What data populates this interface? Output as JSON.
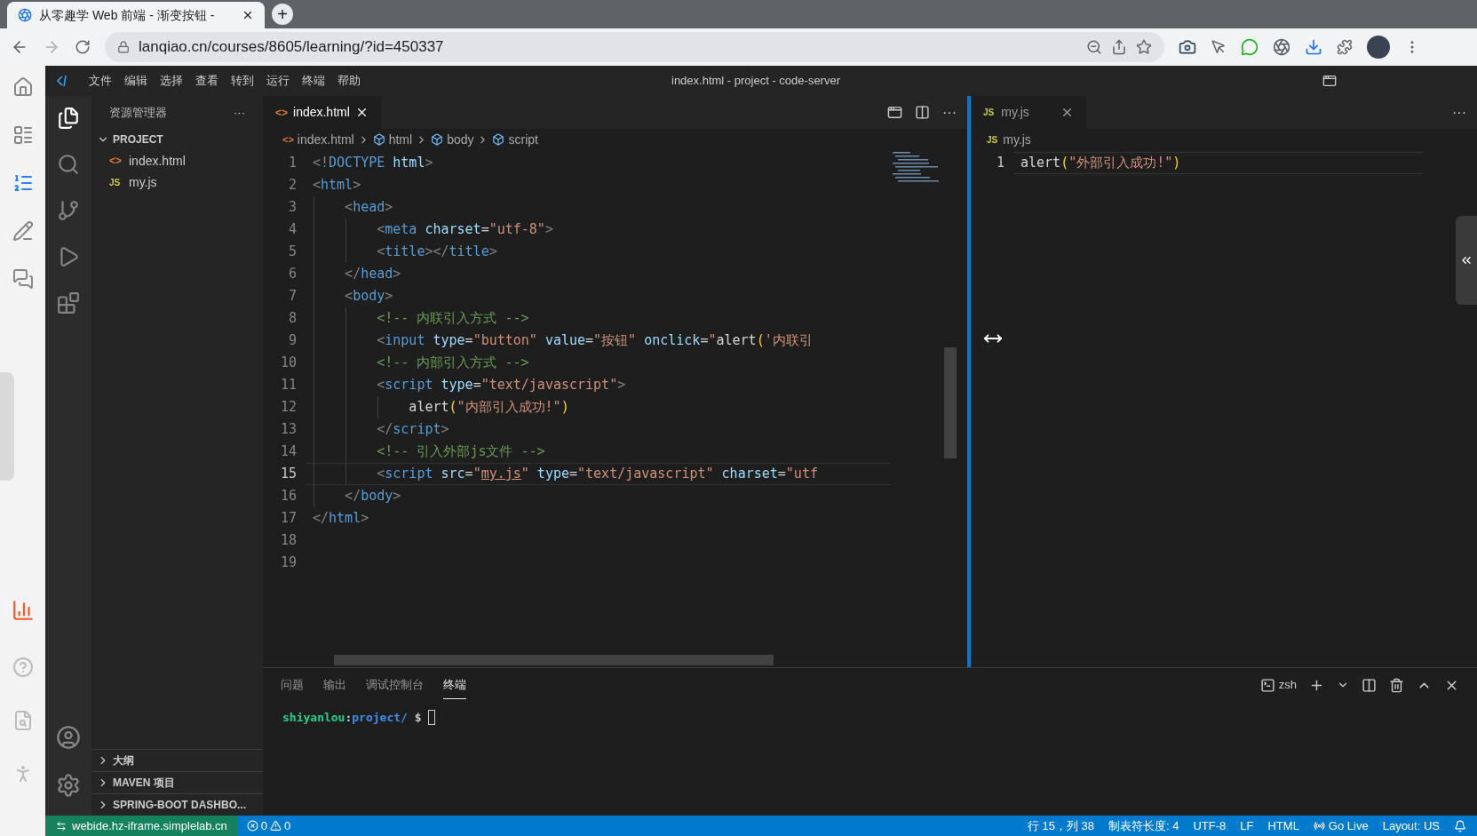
{
  "browser": {
    "tab_title": "从零趣学 Web 前端 - 渐变按钮 -",
    "new_tab": "+",
    "url": "lanqiao.cn/courses/8605/learning/?id=450337"
  },
  "menu": [
    {
      "label": "文件"
    },
    {
      "label": "编辑"
    },
    {
      "label": "选择"
    },
    {
      "label": "查看"
    },
    {
      "label": "转到"
    },
    {
      "label": "运行"
    },
    {
      "label": "终端"
    },
    {
      "label": "帮助"
    }
  ],
  "window": {
    "title": "index.html - project - code-server"
  },
  "explorer": {
    "title": "资源管理器",
    "more": "···",
    "folder": {
      "label": "PROJECT",
      "expanded": true,
      "files": [
        {
          "name": "index.html",
          "kind": "html",
          "icon_text": "<>"
        },
        {
          "name": "my.js",
          "kind": "js",
          "icon_text": "JS"
        }
      ]
    },
    "sections": [
      {
        "label": "大纲",
        "expanded": false
      },
      {
        "label": "MAVEN 项目",
        "expanded": false
      },
      {
        "label": "SPRING-BOOT DASHBO...",
        "expanded": false
      }
    ]
  },
  "left_editor": {
    "tab": {
      "label": "index.html",
      "icon_text": "<>",
      "selected": true
    },
    "more": "···",
    "breadcrumb": [
      "index.html",
      "html",
      "body",
      "script"
    ],
    "breadcrumb_icon_text": "<>",
    "lines": [
      {
        "number": "1",
        "current": false,
        "tokens": [
          {
            "kind": "p",
            "text": "<!"
          },
          {
            "kind": "t",
            "text": "DOCTYPE"
          },
          {
            "kind": "a",
            "text": " html"
          },
          {
            "kind": "p",
            "text": ">"
          }
        ]
      },
      {
        "number": "2",
        "current": false,
        "tokens": [
          {
            "kind": "p",
            "text": "<"
          },
          {
            "kind": "t",
            "text": "html"
          },
          {
            "kind": "p",
            "text": ">"
          }
        ]
      },
      {
        "number": "3",
        "current": false,
        "tokens": [
          {
            "kind": "p",
            "text": "    <"
          },
          {
            "kind": "t",
            "text": "head"
          },
          {
            "kind": "p",
            "text": ">"
          }
        ]
      },
      {
        "number": "4",
        "current": false,
        "tokens": [
          {
            "kind": "p",
            "text": "        <"
          },
          {
            "kind": "t",
            "text": "meta"
          },
          {
            "kind": "a",
            "text": " charset"
          },
          {
            "kind": "x",
            "text": "="
          },
          {
            "kind": "s",
            "text": "\"utf-8\""
          },
          {
            "kind": "p",
            "text": ">"
          }
        ]
      },
      {
        "number": "5",
        "current": false,
        "tokens": [
          {
            "kind": "p",
            "text": "        <"
          },
          {
            "kind": "t",
            "text": "title"
          },
          {
            "kind": "p",
            "text": "></"
          },
          {
            "kind": "t",
            "text": "title"
          },
          {
            "kind": "p",
            "text": ">"
          }
        ]
      },
      {
        "number": "6",
        "current": false,
        "tokens": [
          {
            "kind": "p",
            "text": "    </"
          },
          {
            "kind": "t",
            "text": "head"
          },
          {
            "kind": "p",
            "text": ">"
          }
        ]
      },
      {
        "number": "7",
        "current": false,
        "tokens": [
          {
            "kind": "p",
            "text": "    <"
          },
          {
            "kind": "t",
            "text": "body"
          },
          {
            "kind": "p",
            "text": ">"
          }
        ]
      },
      {
        "number": "8",
        "current": false,
        "tokens": [
          {
            "kind": "c",
            "text": "        <!-- 内联引入方式 -->"
          }
        ]
      },
      {
        "number": "9",
        "current": false,
        "tokens": [
          {
            "kind": "p",
            "text": "        <"
          },
          {
            "kind": "t",
            "text": "input"
          },
          {
            "kind": "a",
            "text": " type"
          },
          {
            "kind": "x",
            "text": "="
          },
          {
            "kind": "s",
            "text": "\"button\""
          },
          {
            "kind": "a",
            "text": " value"
          },
          {
            "kind": "x",
            "text": "="
          },
          {
            "kind": "s",
            "text": "\"按钮\""
          },
          {
            "kind": "a",
            "text": " onclick"
          },
          {
            "kind": "x",
            "text": "="
          },
          {
            "kind": "s",
            "text": "\""
          },
          {
            "kind": "x",
            "text": "alert"
          },
          {
            "kind": "b",
            "text": "("
          },
          {
            "kind": "s",
            "text": "'内联引"
          }
        ]
      },
      {
        "number": "10",
        "current": false,
        "tokens": [
          {
            "kind": "c",
            "text": "        <!-- 内部引入方式 -->"
          }
        ]
      },
      {
        "number": "11",
        "current": false,
        "tokens": [
          {
            "kind": "p",
            "text": "        <"
          },
          {
            "kind": "t",
            "text": "script"
          },
          {
            "kind": "a",
            "text": " type"
          },
          {
            "kind": "x",
            "text": "="
          },
          {
            "kind": "s",
            "text": "\"text/javascript\""
          },
          {
            "kind": "p",
            "text": ">"
          }
        ]
      },
      {
        "number": "12",
        "current": false,
        "tokens": [
          {
            "kind": "x",
            "text": "            alert"
          },
          {
            "kind": "b",
            "text": "("
          },
          {
            "kind": "s",
            "text": "\"内部引入成功!\""
          },
          {
            "kind": "b",
            "text": ")"
          }
        ]
      },
      {
        "number": "13",
        "current": false,
        "tokens": [
          {
            "kind": "p",
            "text": "        </"
          },
          {
            "kind": "t",
            "text": "script"
          },
          {
            "kind": "p",
            "text": ">"
          }
        ]
      },
      {
        "number": "14",
        "current": false,
        "tokens": [
          {
            "kind": "c",
            "text": "        <!-- 引入外部js文件 -->"
          }
        ]
      },
      {
        "number": "15",
        "current": true,
        "tokens": [
          {
            "kind": "p",
            "text": "        <"
          },
          {
            "kind": "t",
            "text": "script"
          },
          {
            "kind": "a",
            "text": " src"
          },
          {
            "kind": "x",
            "text": "="
          },
          {
            "kind": "s",
            "text": "\""
          },
          {
            "kind": "u",
            "text": "my.js"
          },
          {
            "kind": "s",
            "text": "\""
          },
          {
            "kind": "a",
            "text": " type"
          },
          {
            "kind": "x",
            "text": "="
          },
          {
            "kind": "s",
            "text": "\"text/javascript\""
          },
          {
            "kind": "a",
            "text": " charset"
          },
          {
            "kind": "x",
            "text": "="
          },
          {
            "kind": "s",
            "text": "\"utf"
          }
        ]
      },
      {
        "number": "16",
        "current": false,
        "tokens": [
          {
            "kind": "p",
            "text": "    </"
          },
          {
            "kind": "t",
            "text": "body"
          },
          {
            "kind": "p",
            "text": ">"
          }
        ]
      },
      {
        "number": "17",
        "current": false,
        "tokens": [
          {
            "kind": "p",
            "text": "</"
          },
          {
            "kind": "t",
            "text": "html"
          },
          {
            "kind": "p",
            "text": ">"
          }
        ]
      },
      {
        "number": "18",
        "current": false
      },
      {
        "number": "19",
        "current": false
      }
    ]
  },
  "right_editor": {
    "tab": {
      "label": "my.js",
      "icon_text": "JS",
      "selected": true
    },
    "more": "···",
    "breadcrumb": [
      "my.js"
    ],
    "breadcrumb_icon_text": "JS",
    "lines": [
      {
        "number": "1",
        "current": true,
        "tokens": [
          {
            "kind": "x",
            "text": "alert"
          },
          {
            "kind": "b",
            "text": "("
          },
          {
            "kind": "s",
            "text": "\"外部引入成功!\""
          },
          {
            "kind": "b",
            "text": ")"
          }
        ]
      }
    ]
  },
  "panel": {
    "tabs": [
      {
        "label": "问题",
        "selected": false
      },
      {
        "label": "输出",
        "selected": false
      },
      {
        "label": "调试控制台",
        "selected": false
      },
      {
        "label": "终端",
        "selected": true
      }
    ],
    "shell": "zsh",
    "prompt": {
      "user": "shiyanlou",
      "separator": ":",
      "path": "project/",
      "symbol": "$"
    }
  },
  "status_bar": {
    "remote": "webide.hz-iframe.simplelab.cn",
    "errors": "0",
    "warnings": "0",
    "position": "行 15，列 38",
    "indent": "制表符长度: 4",
    "encoding": "UTF-8",
    "eol": "LF",
    "language": "HTML",
    "go_live": "Go Live",
    "layout": "Layout: US"
  }
}
